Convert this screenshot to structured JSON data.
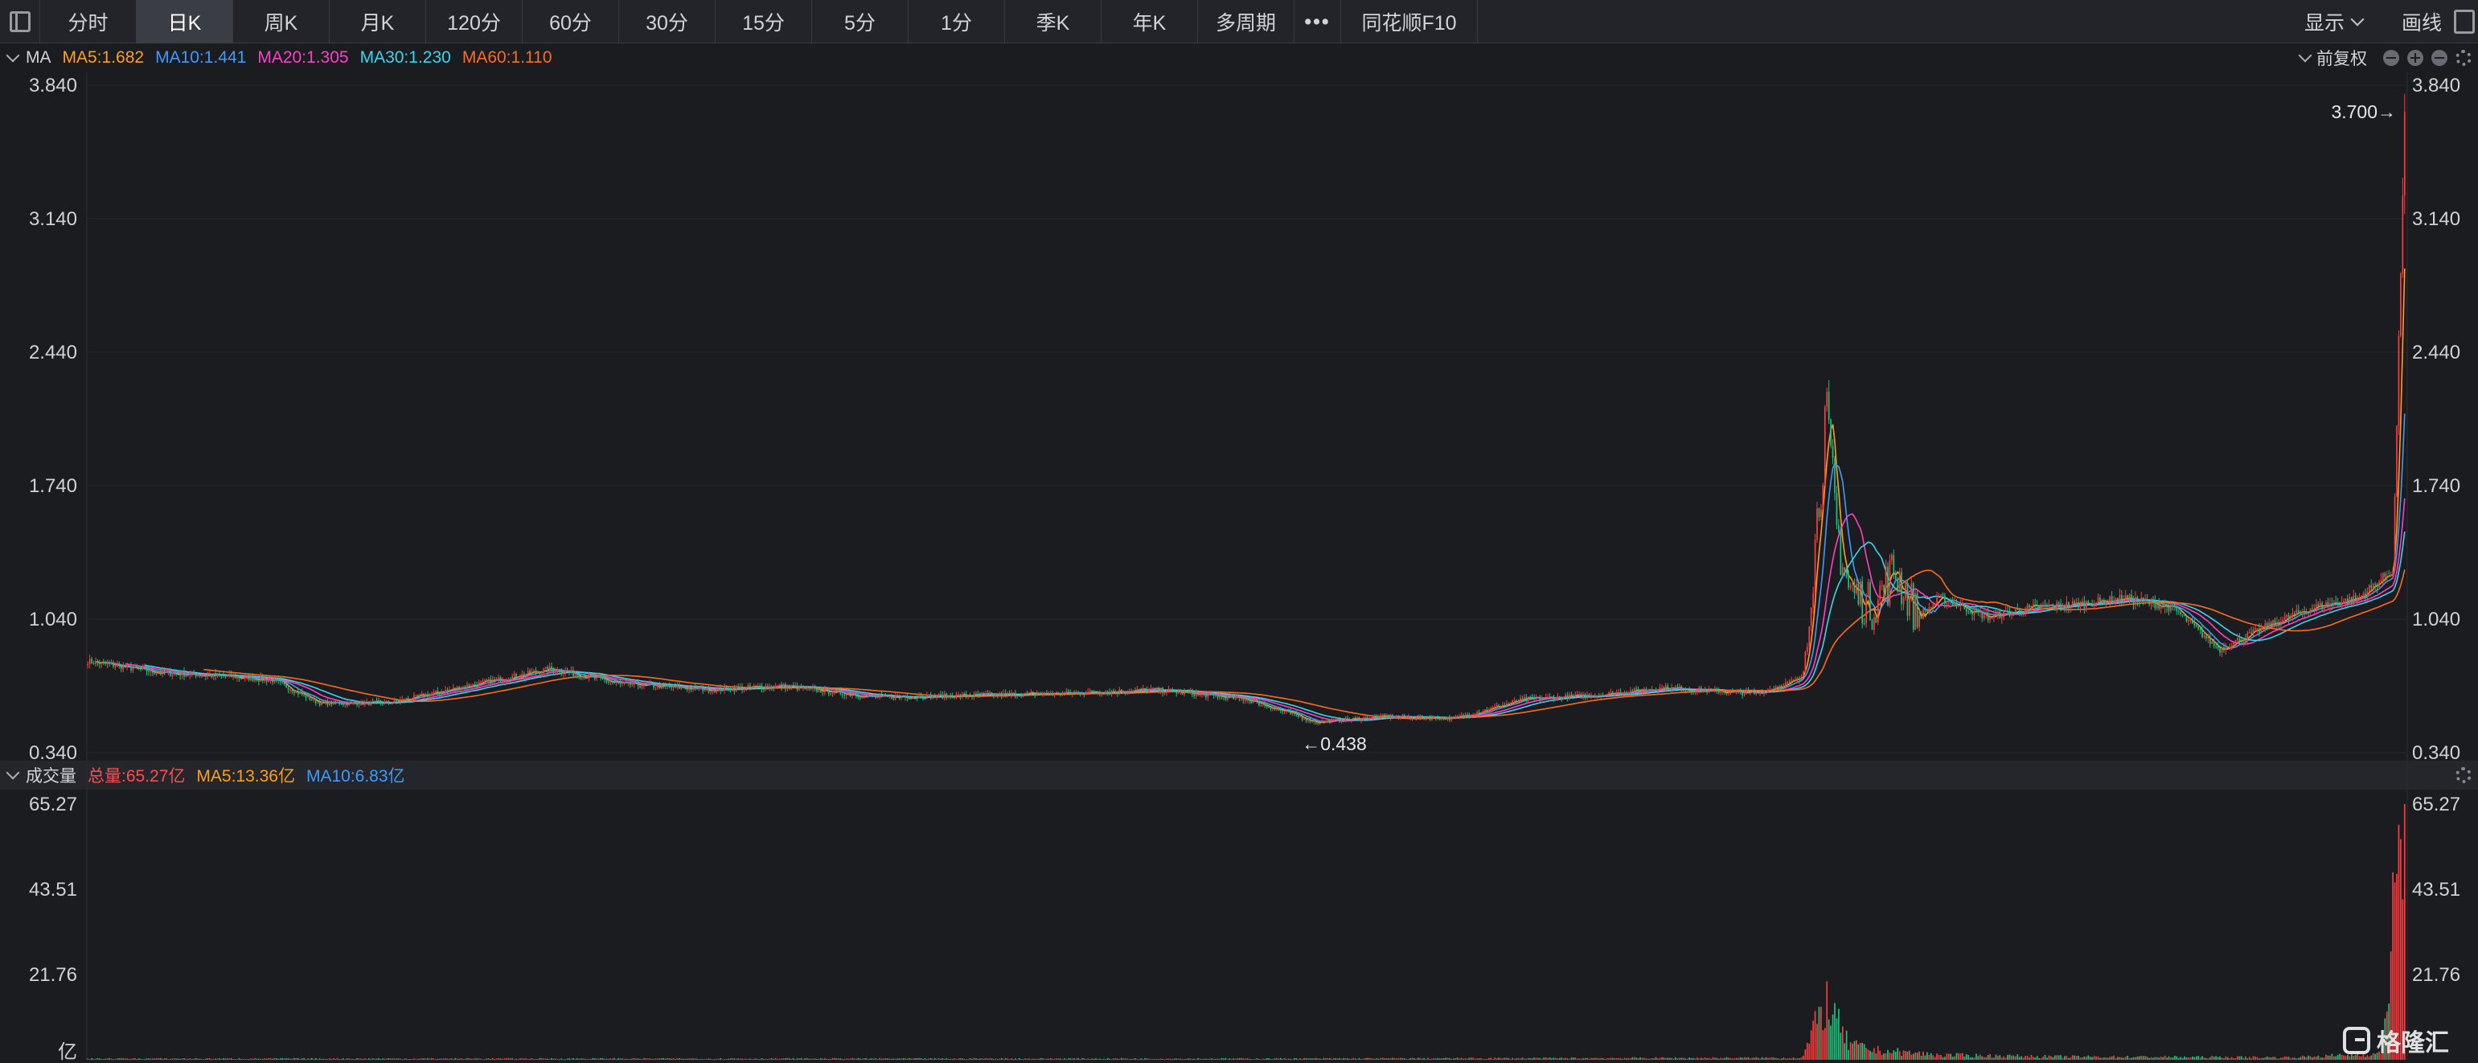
{
  "toolbar": {
    "tabs": [
      "分时",
      "日K",
      "周K",
      "月K",
      "120分",
      "60分",
      "30分",
      "15分",
      "5分",
      "1分",
      "季K",
      "年K",
      "多周期"
    ],
    "active_tab": "日K",
    "more_label": "•••",
    "f10_label": "同花顺F10",
    "display_label": "显示",
    "draw_label": "画线"
  },
  "price_legend": {
    "label": "MA",
    "items": [
      {
        "text": "MA5:1.682",
        "color": "#ff9f1c"
      },
      {
        "text": "MA10:1.441",
        "color": "#3d9bff"
      },
      {
        "text": "MA20:1.305",
        "color": "#ff3fc8"
      },
      {
        "text": "MA30:1.230",
        "color": "#38d7ee"
      },
      {
        "text": "MA60:1.110",
        "color": "#ff6a21"
      }
    ],
    "adjust_label": "前复权"
  },
  "volume_legend": {
    "label": "成交量",
    "items": [
      {
        "text": "总量:65.27亿",
        "color": "#ff4d4f"
      },
      {
        "text": "MA5:13.36亿",
        "color": "#ff9f1c"
      },
      {
        "text": "MA10:6.83亿",
        "color": "#3d9bff"
      }
    ]
  },
  "logo_text": "格隆汇",
  "colors": {
    "up": "#ff3b3b",
    "down": "#19c37d",
    "background": "#1b1c20"
  },
  "chart_data": [
    {
      "type": "candlestick",
      "price_axis_ticks": [
        "3.840",
        "3.140",
        "2.440",
        "1.740",
        "1.040",
        "0.340"
      ],
      "ylim": [
        0.34,
        3.84
      ],
      "annotations": {
        "high_label": "3.700→",
        "low_label": "←0.438"
      },
      "high_value": 3.7,
      "low_value": 0.438,
      "price_path": [
        [
          0,
          0.82
        ],
        [
          0.03,
          0.76
        ],
        [
          0.06,
          0.74
        ],
        [
          0.08,
          0.72
        ],
        [
          0.1,
          0.6
        ],
        [
          0.13,
          0.6
        ],
        [
          0.16,
          0.68
        ],
        [
          0.2,
          0.78
        ],
        [
          0.23,
          0.7
        ],
        [
          0.27,
          0.67
        ],
        [
          0.3,
          0.69
        ],
        [
          0.34,
          0.63
        ],
        [
          0.38,
          0.64
        ],
        [
          0.42,
          0.65
        ],
        [
          0.46,
          0.67
        ],
        [
          0.5,
          0.62
        ],
        [
          0.53,
          0.5
        ],
        [
          0.56,
          0.53
        ],
        [
          0.59,
          0.52
        ],
        [
          0.62,
          0.62
        ],
        [
          0.65,
          0.64
        ],
        [
          0.68,
          0.68
        ],
        [
          0.72,
          0.65
        ],
        [
          0.74,
          0.73
        ],
        [
          0.745,
          1.35
        ],
        [
          0.75,
          2.1
        ],
        [
          0.755,
          1.5
        ],
        [
          0.76,
          1.2
        ],
        [
          0.77,
          1.1
        ],
        [
          0.78,
          1.3
        ],
        [
          0.79,
          1.05
        ],
        [
          0.8,
          1.15
        ],
        [
          0.82,
          1.05
        ],
        [
          0.84,
          1.1
        ],
        [
          0.86,
          1.12
        ],
        [
          0.88,
          1.15
        ],
        [
          0.9,
          1.1
        ],
        [
          0.92,
          0.88
        ],
        [
          0.94,
          1.0
        ],
        [
          0.96,
          1.1
        ],
        [
          0.98,
          1.15
        ],
        [
          0.995,
          1.3
        ],
        [
          1,
          3.7
        ]
      ]
    },
    {
      "type": "bar",
      "name": "成交量",
      "volume_axis_ticks": [
        "65.27",
        "43.51",
        "21.76"
      ],
      "unit_label": "亿",
      "ylim": [
        0,
        65.27
      ],
      "last_volume": 65.27,
      "volume_path": [
        [
          0,
          0.3
        ],
        [
          0.5,
          0.3
        ],
        [
          0.74,
          0.5
        ],
        [
          0.745,
          7.5
        ],
        [
          0.75,
          15
        ],
        [
          0.76,
          4
        ],
        [
          0.77,
          2.5
        ],
        [
          0.8,
          1.2
        ],
        [
          0.85,
          0.8
        ],
        [
          0.9,
          0.7
        ],
        [
          0.95,
          0.6
        ],
        [
          0.99,
          1.5
        ],
        [
          1,
          65.27
        ]
      ]
    }
  ]
}
